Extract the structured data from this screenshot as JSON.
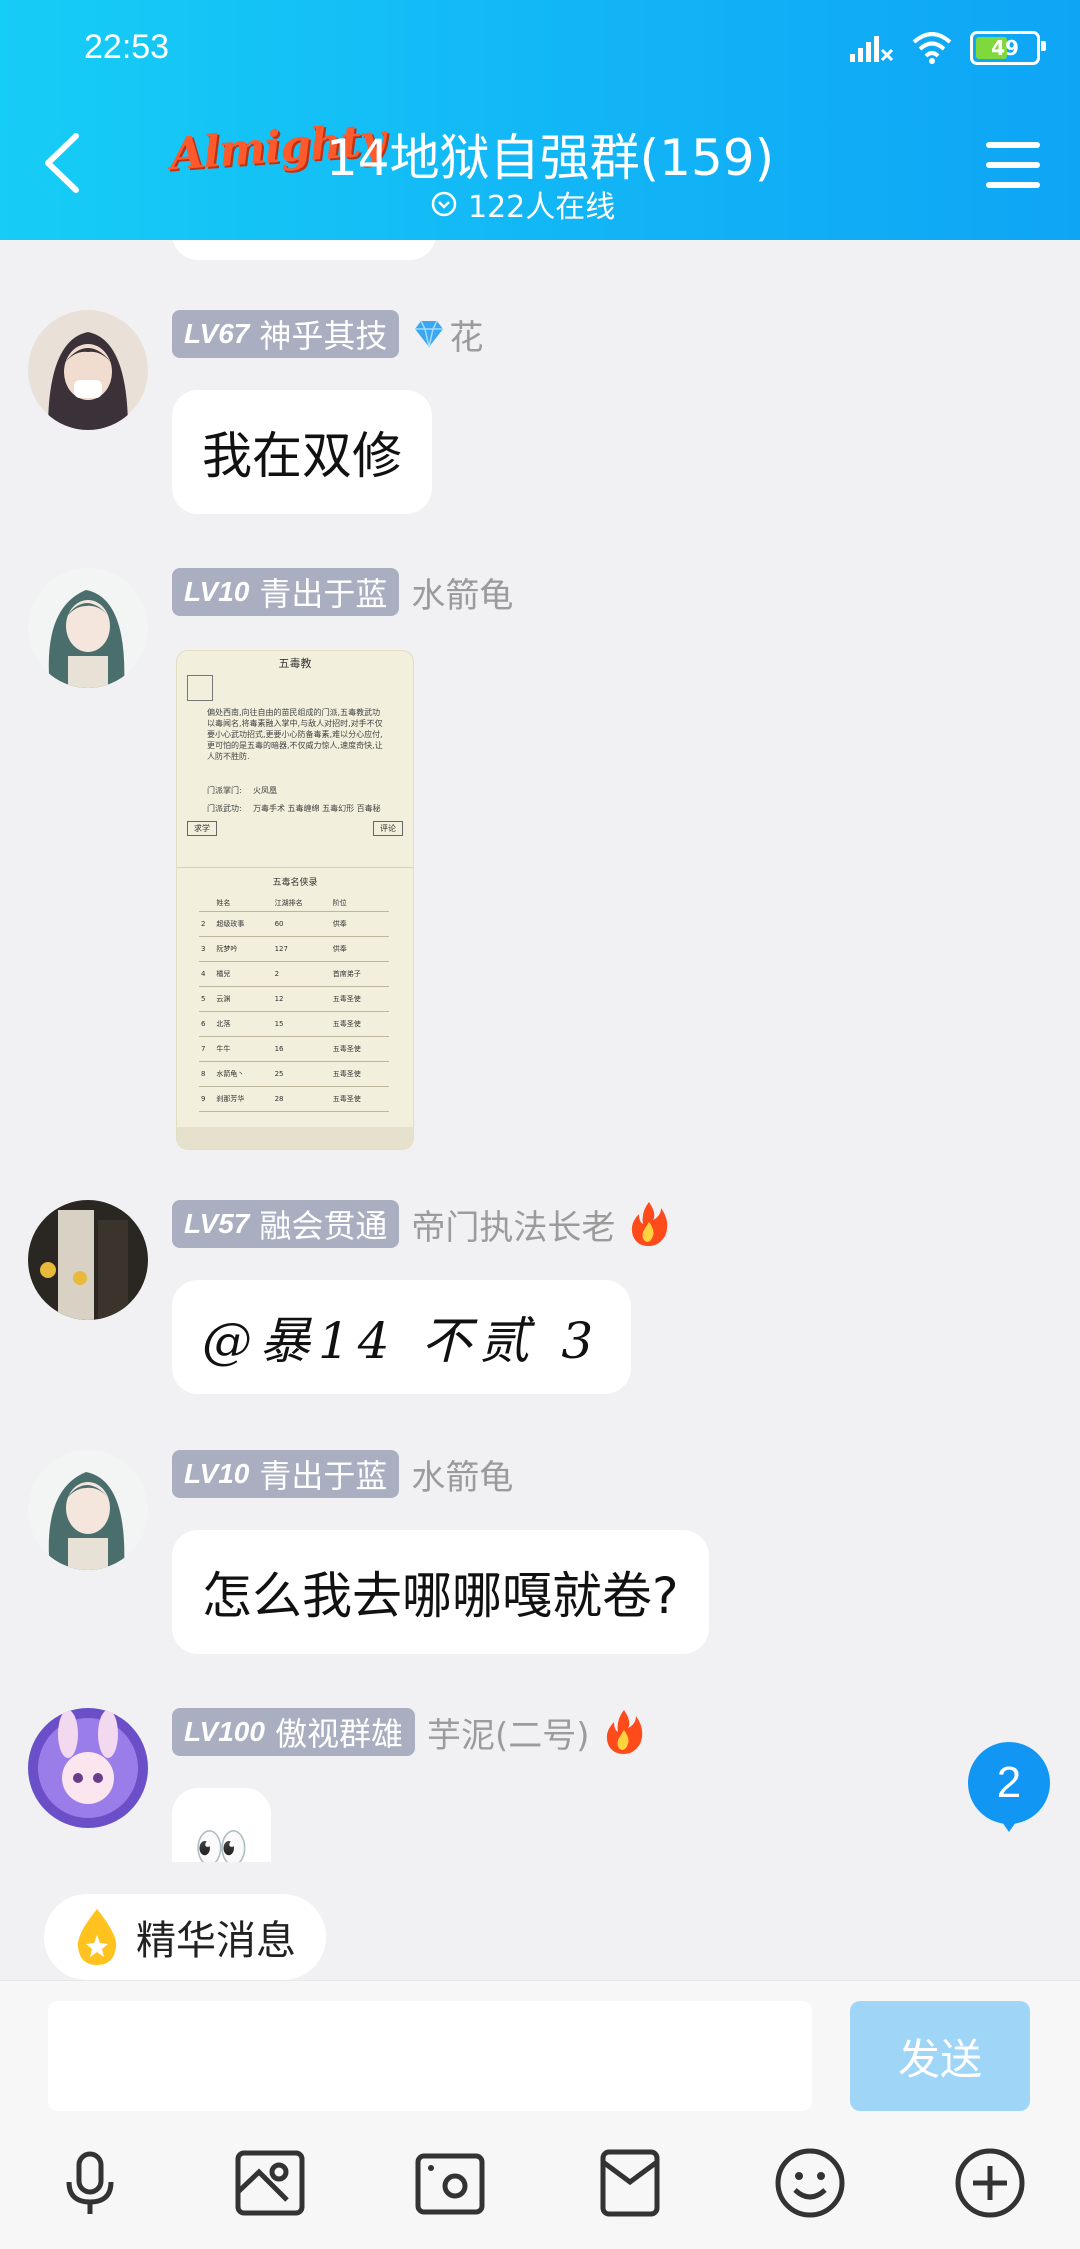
{
  "status": {
    "time": "22:53",
    "battery": "49"
  },
  "header": {
    "logo_text": "Almighty",
    "title": "14地狱自强群(159)",
    "online": "122人在线"
  },
  "messages": [
    {
      "level": "LV67",
      "rank": "神乎其技",
      "nickname": "花",
      "text": "我在双修"
    },
    {
      "level": "LV10",
      "rank": "青出于蓝",
      "nickname": "水箭龟",
      "image": {
        "title": "五毒教",
        "paragraph": "偏处西南,向往自由的苗民组成的门派,五毒教武功以毒闻名,将毒素融入掌中,与敌人对招时,对手不仅要小心武功招式,更要小心防备毒素,难以分心应付,更可怕的是五毒的暗器,不仅威力惊人,速度奇快,让人防不胜防.",
        "master_label": "门派掌门:",
        "master": "火凤凰",
        "skills_label": "门派武功:",
        "skills": "万毒手术  五毒缠绵  五毒幻形  百毒秘",
        "btn_learn": "求学",
        "btn_review": "评论",
        "subtitle": "五毒名侠录",
        "headers": [
          "姓名",
          "江湖排名",
          "阶位"
        ],
        "rows": [
          [
            "2",
            "超级玫事",
            "60",
            "供奉"
          ],
          [
            "3",
            "阮梦吟",
            "127",
            "供奉"
          ],
          [
            "4",
            "橘兒",
            "2",
            "首席弟子"
          ],
          [
            "5",
            "云渊",
            "12",
            "五毒圣使"
          ],
          [
            "6",
            "北落",
            "15",
            "五毒圣使"
          ],
          [
            "7",
            "牛牛",
            "16",
            "五毒圣使"
          ],
          [
            "8",
            "水箭龟丶",
            "25",
            "五毒圣使"
          ],
          [
            "9",
            "刹那芳华",
            "28",
            "五毒圣使"
          ]
        ]
      }
    },
    {
      "level": "LV57",
      "rank": "融会贯通",
      "nickname": "帝门执法长老",
      "text": "@暴14  不贰 3"
    },
    {
      "level": "LV10",
      "rank": "青出于蓝",
      "nickname": "水箭龟",
      "text": "怎么我去哪哪嘎就卷?"
    },
    {
      "level": "LV100",
      "rank": "傲视群雄",
      "nickname": "芋泥(二号)",
      "text": "👀"
    }
  ],
  "unread_count": "2",
  "essence_label": "精华消息",
  "input": {
    "send_label": "发送"
  },
  "colors": {
    "header_start": "#16cdf6",
    "header_end": "#0ea5f5",
    "badge": "#a9aec0",
    "accent": "#1296f4"
  }
}
